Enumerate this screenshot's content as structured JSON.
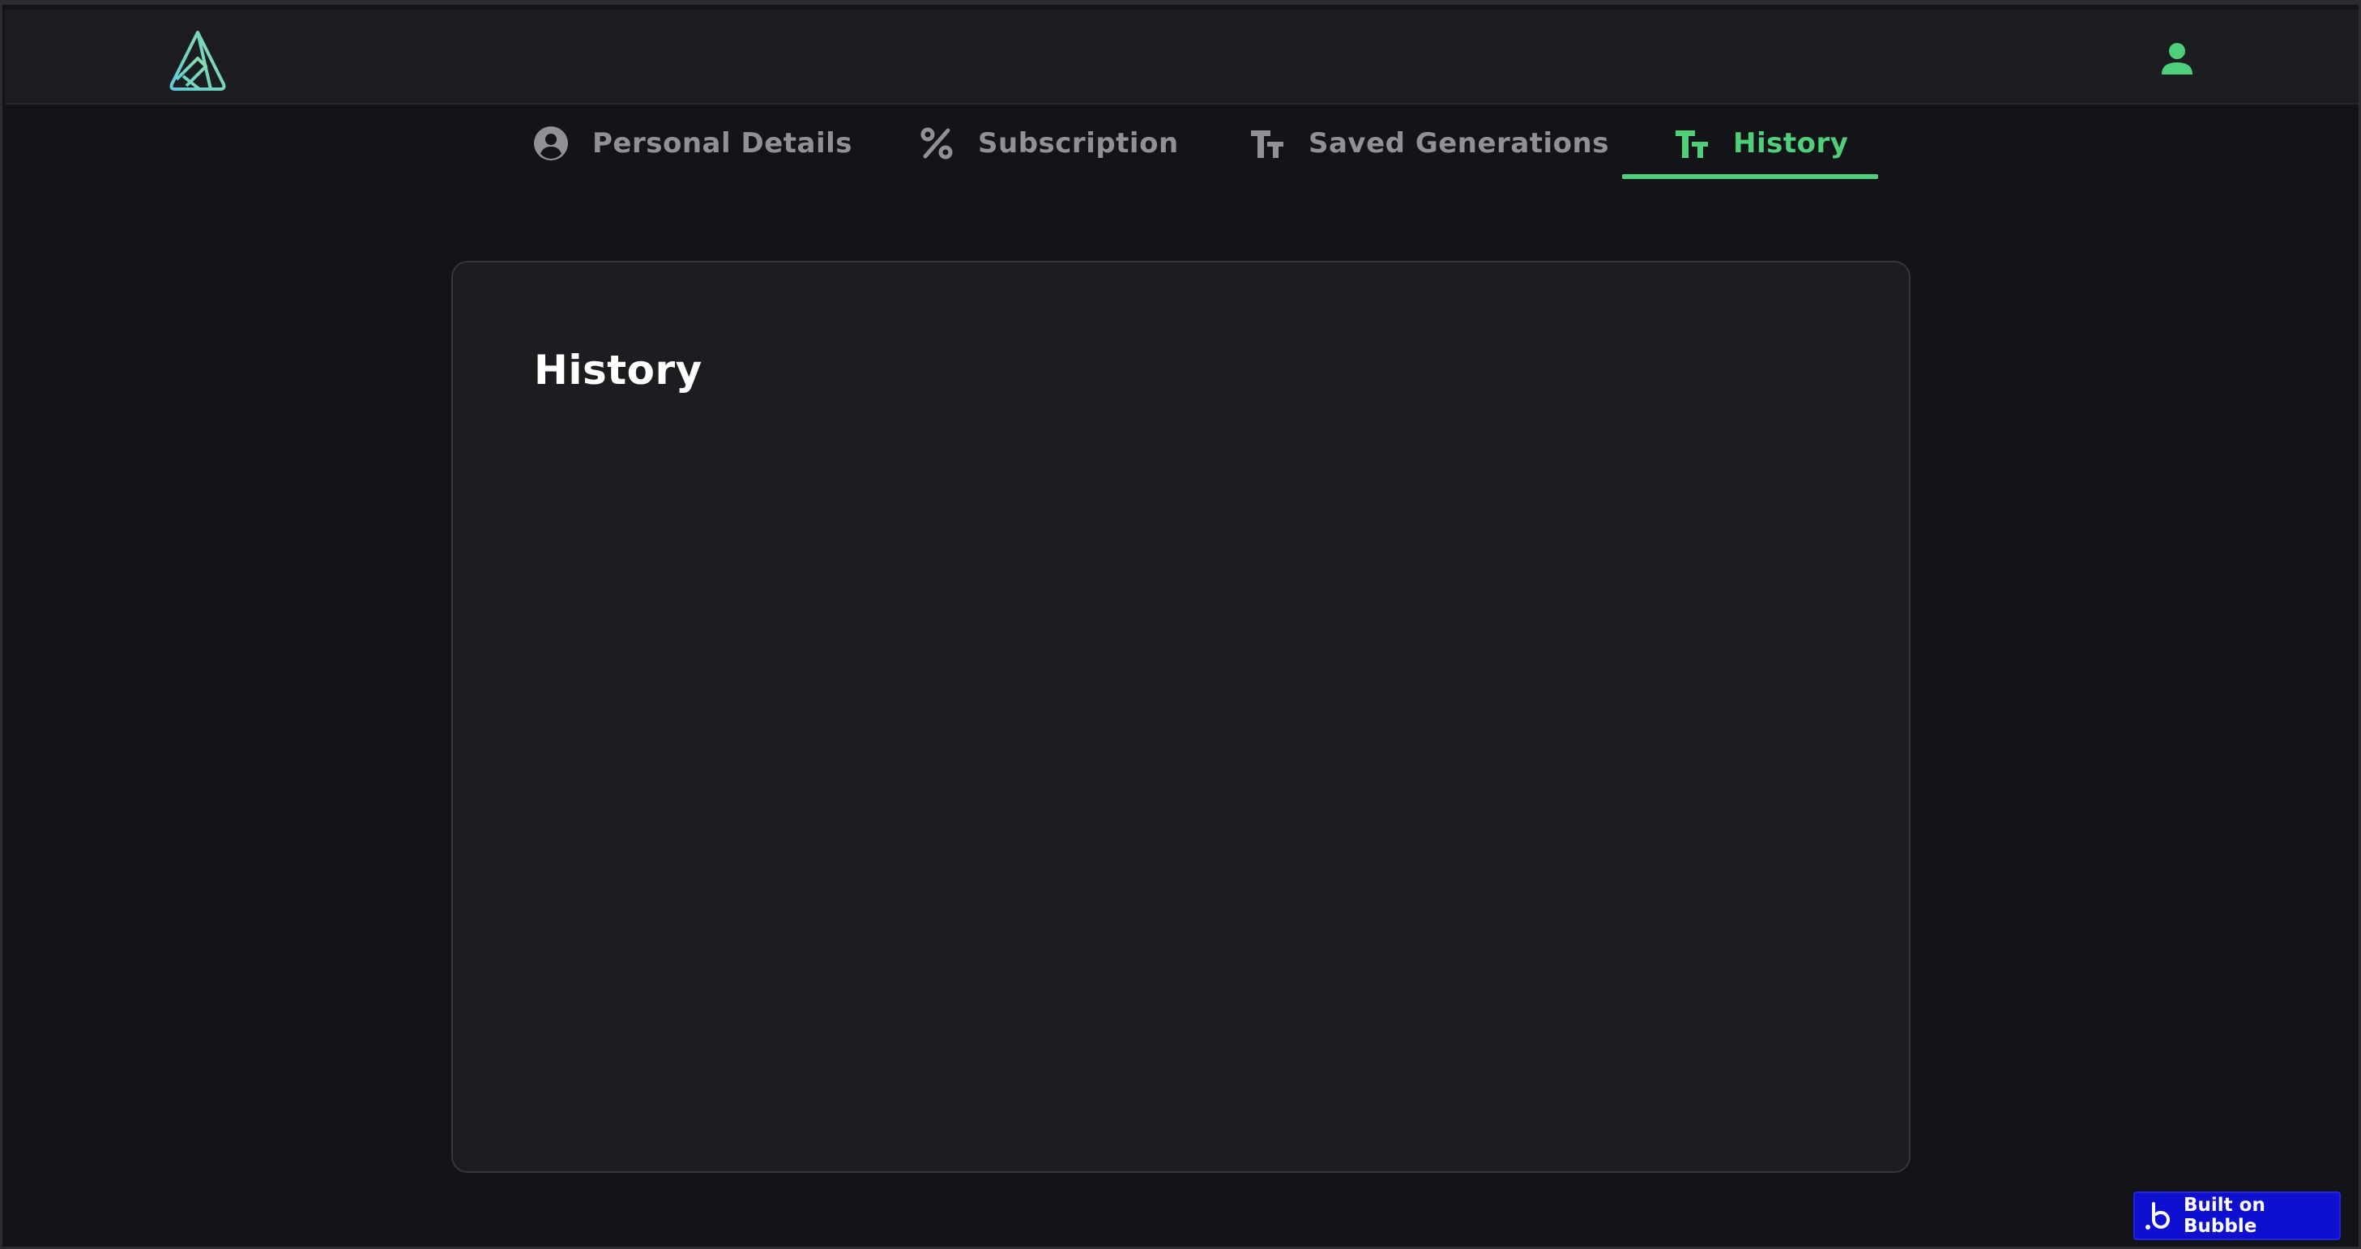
{
  "header": {
    "logo_icon": "triangle-logo-icon",
    "user_icon": "user-icon",
    "accent_color": "#4fcf7a"
  },
  "tabs": [
    {
      "label": "Personal Details",
      "icon": "user-circle-icon",
      "active": false
    },
    {
      "label": "Subscription",
      "icon": "percent-icon",
      "active": false
    },
    {
      "label": "Saved Generations",
      "icon": "text-size-icon",
      "active": false
    },
    {
      "label": "History",
      "icon": "text-size-icon",
      "active": true
    }
  ],
  "main": {
    "title": "History"
  },
  "badge": {
    "label": "Built on Bubble",
    "color": "#0f0fcf"
  }
}
